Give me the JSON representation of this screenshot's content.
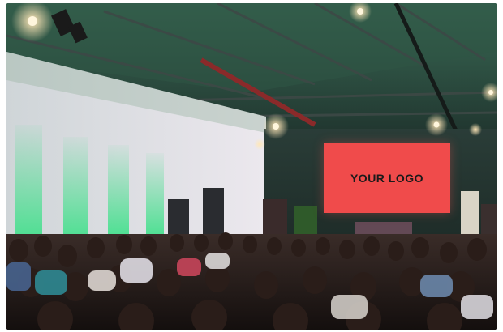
{
  "screen": {
    "text": "YOUR LOGO"
  },
  "colors": {
    "screen": "#f04b4b",
    "accent_light": "#3fe08a",
    "ceiling": "#2b3a36",
    "wall": "#e8e6ea"
  }
}
